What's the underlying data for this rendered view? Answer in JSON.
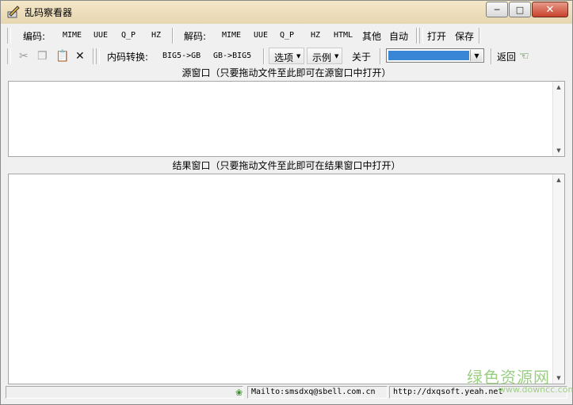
{
  "window": {
    "title": "乱码察看器"
  },
  "toolbar1": {
    "encode_label": "编码:",
    "encode_items": [
      "MIME",
      "UUE",
      "Q_P",
      "HZ"
    ],
    "decode_label": "解码:",
    "decode_items": [
      "MIME",
      "UUE",
      "Q_P",
      "HZ",
      "HTML"
    ],
    "other": "其他",
    "auto": "自动",
    "open": "打开",
    "save": "保存"
  },
  "toolbar2": {
    "convert_label": "内码转换:",
    "big5_to_gb": "BIG5->GB",
    "gb_to_big5": "GB->BIG5",
    "options": "选项",
    "examples": "示例",
    "about": "关于",
    "back": "返回",
    "icons": {
      "cut": "scissors-icon",
      "copy": "copy-icon",
      "paste": "paste-icon",
      "delete": "x-icon"
    }
  },
  "source_pane": {
    "header": "源窗口（只要拖动文件至此即可在源窗口中打开）"
  },
  "result_pane": {
    "header": "结果窗口（只要拖动文件至此即可在结果窗口中打开）"
  },
  "statusbar": {
    "mail": "Mailto:smsdxq@sbell.com.cn",
    "url": "http://dxqsoft.yeah.net"
  },
  "watermark": {
    "text": "绿色资源网",
    "site": "www.downcc.com"
  },
  "colors": {
    "combo_selection": "#3a86d6",
    "close_button": "#c8422c",
    "titlebar": "#e6d6b0"
  }
}
